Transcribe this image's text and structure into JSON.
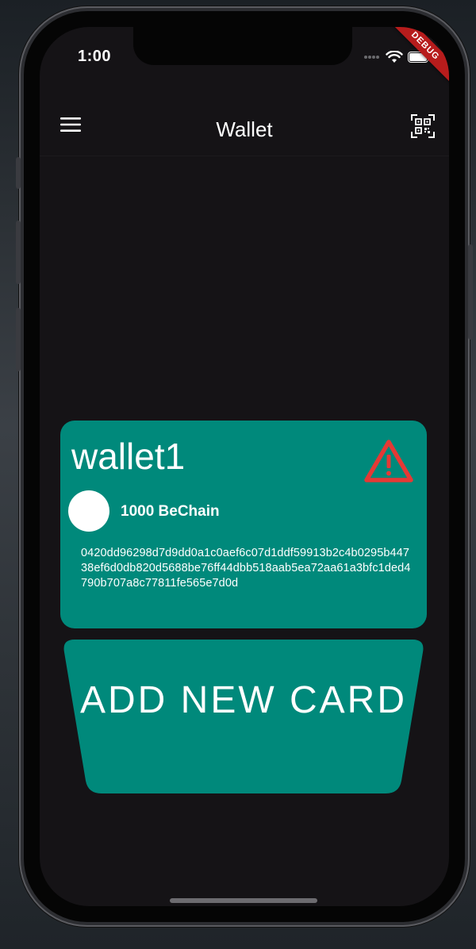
{
  "status_bar": {
    "time": "1:00",
    "debug_label": "DEBUG"
  },
  "appbar": {
    "title": "Wallet",
    "menu_icon": "menu-icon",
    "qr_icon": "qr-scan-icon"
  },
  "wallet_card": {
    "name": "wallet1",
    "warning_icon": "warning-icon",
    "balance": "1000 BeChain",
    "address": "0420dd96298d7d9dd0a1c0aef6c07d1ddf59913b2c4b0295b44738ef6d0db820d5688be76ff44dbb518aab5ea72aa61a3bfc1ded4790b707a8c77811fe565e7d0d",
    "card_color": "#00897b",
    "warning_color": "#e53935"
  },
  "add_card_button": {
    "label": "ADD NEW CARD"
  },
  "colors": {
    "background": "#151316",
    "accent": "#00897b"
  }
}
